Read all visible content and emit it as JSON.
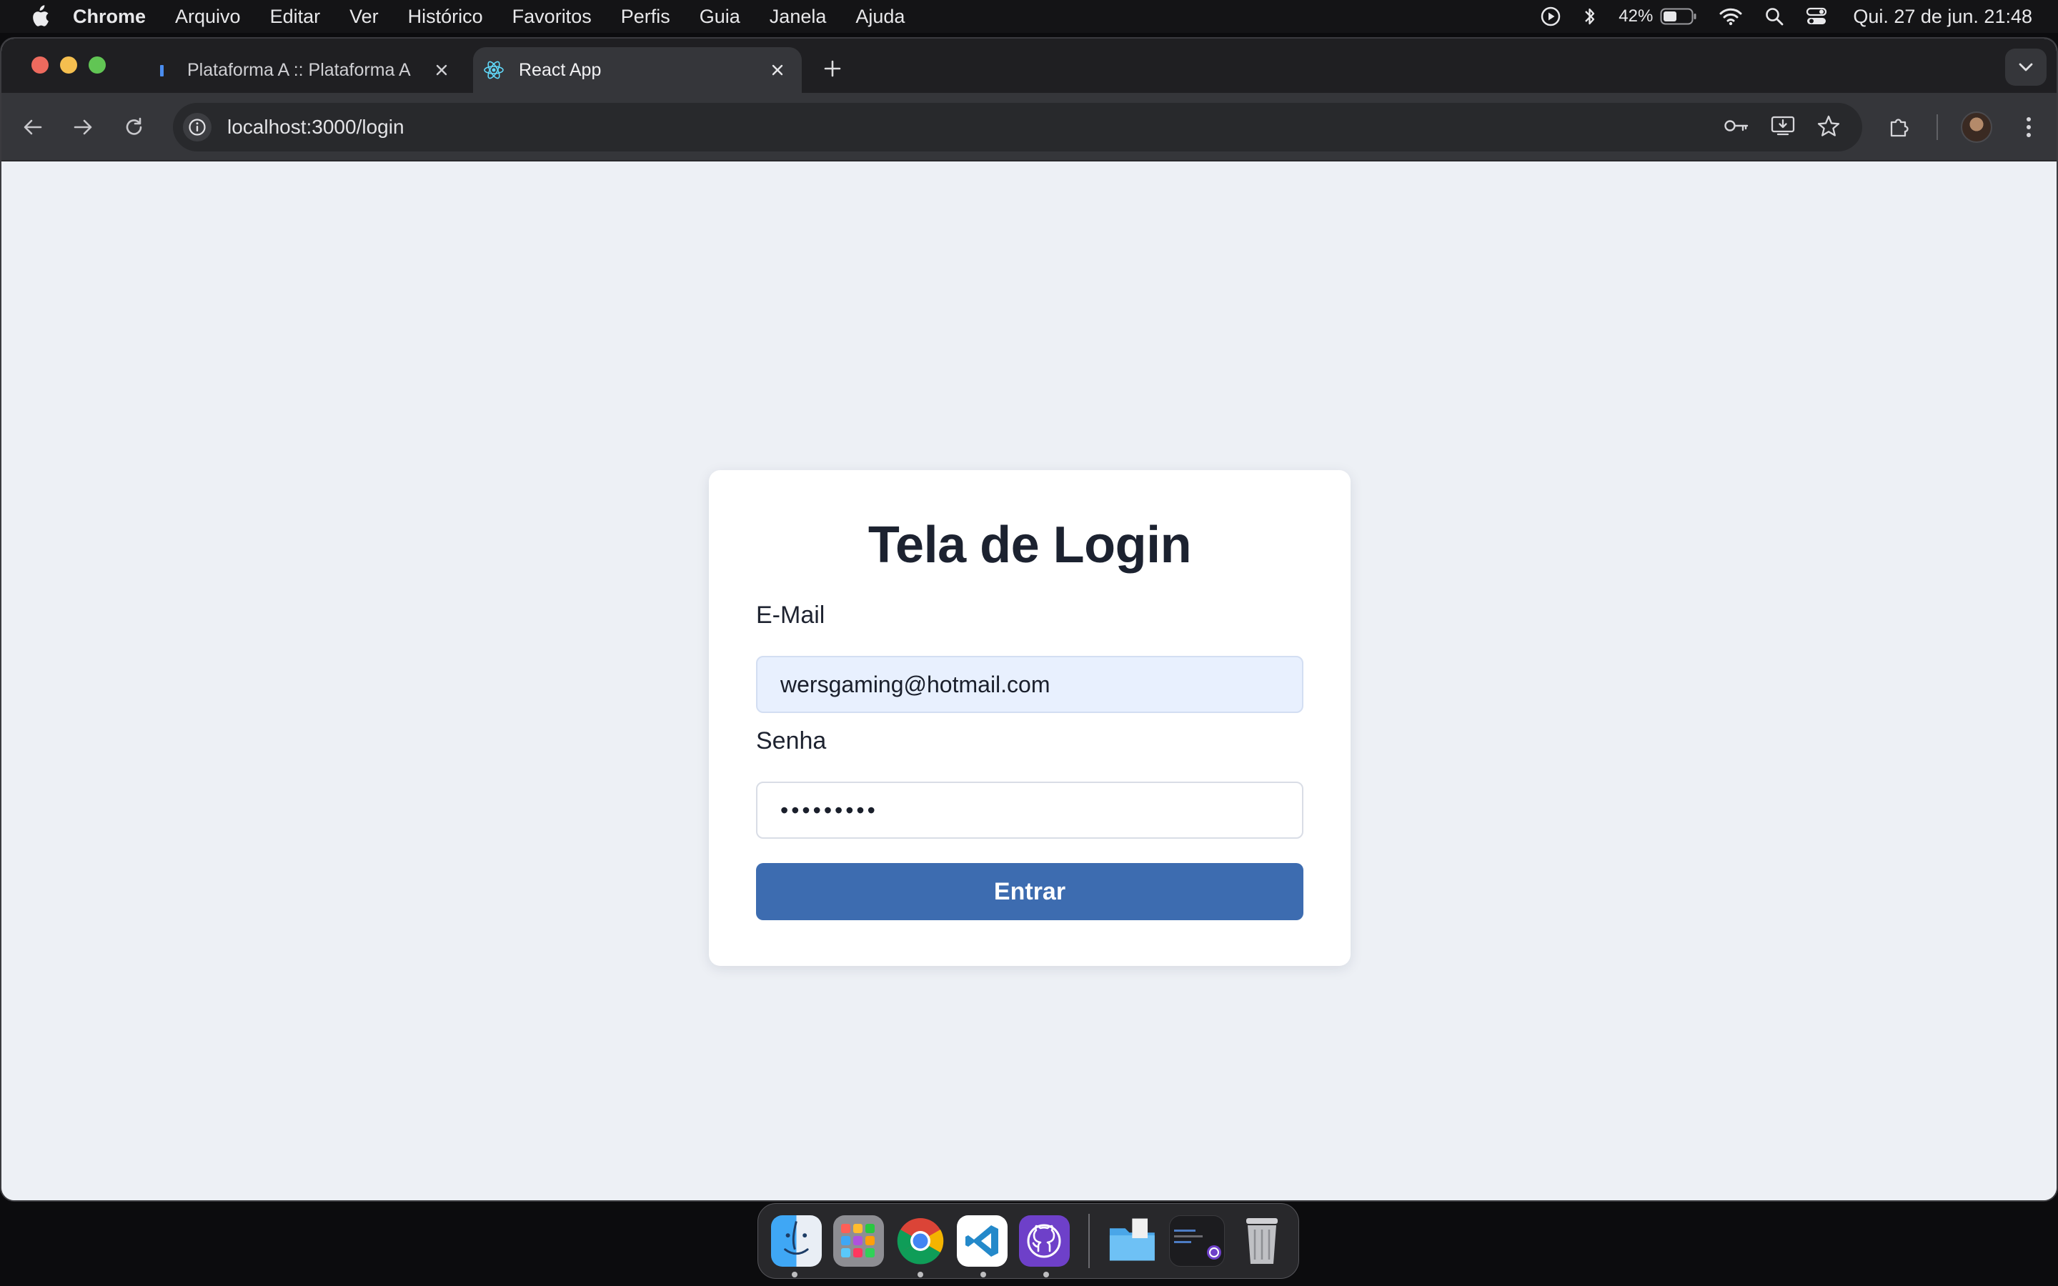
{
  "menubar": {
    "app_name": "Chrome",
    "menus": [
      "Arquivo",
      "Editar",
      "Ver",
      "Histórico",
      "Favoritos",
      "Perfis",
      "Guia",
      "Janela",
      "Ajuda"
    ],
    "battery": "42%",
    "clock": "Qui. 27 de jun.  21:48"
  },
  "tabs": [
    {
      "title": "Plataforma A :: Plataforma A",
      "active": false
    },
    {
      "title": "React App",
      "active": true
    }
  ],
  "toolbar": {
    "url": "localhost:3000/login"
  },
  "login": {
    "title": "Tela de Login",
    "email_label": "E-Mail",
    "email_value": "wersgaming@hotmail.com",
    "password_label": "Senha",
    "password_value": "•••••••••",
    "submit_label": "Entrar"
  },
  "dock": {
    "apps": [
      "finder",
      "launchpad",
      "chrome",
      "vscode",
      "github-desktop",
      "downloads-folder",
      "terminal-window",
      "trash"
    ]
  },
  "colors": {
    "page_bg": "#edf0f5",
    "button": "#3d6cb0",
    "autofill_bg": "#e8f0fe"
  }
}
